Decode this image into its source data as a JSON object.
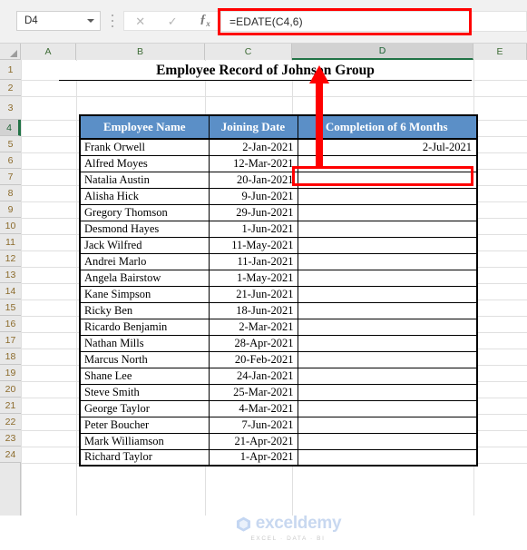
{
  "formula_bar": {
    "name_box_value": "D4",
    "formula": "=EDATE(C4,6)",
    "cancel_icon": "close-icon",
    "confirm_icon": "check-icon",
    "function_icon": "fx-icon",
    "highlight_color": "#ff0000"
  },
  "grid": {
    "column_headers": [
      "A",
      "B",
      "C",
      "D",
      "E"
    ],
    "active_column": "D",
    "active_row": 4,
    "row_headers": [
      1,
      2,
      3,
      4,
      5,
      6,
      7,
      8,
      9,
      10,
      11,
      12,
      13,
      14,
      15,
      16,
      17,
      18,
      19,
      20,
      21,
      22,
      23,
      24
    ],
    "header_accent": "#217346"
  },
  "sheet": {
    "title": "Employee Record of Johnson Group",
    "table": {
      "header_bg": "#5b8fc7",
      "header_text_color": "#ffffff",
      "columns": [
        "Employee Name",
        "Joining Date",
        "Completion of 6 Months"
      ],
      "rows": [
        {
          "name": "Frank Orwell",
          "joining": "2-Jan-2021",
          "completion": "2-Jul-2021"
        },
        {
          "name": "Alfred Moyes",
          "joining": "12-Mar-2021",
          "completion": ""
        },
        {
          "name": "Natalia Austin",
          "joining": "20-Jan-2021",
          "completion": ""
        },
        {
          "name": "Alisha Hick",
          "joining": "9-Jun-2021",
          "completion": ""
        },
        {
          "name": "Gregory Thomson",
          "joining": "29-Jun-2021",
          "completion": ""
        },
        {
          "name": "Desmond Hayes",
          "joining": "1-Jun-2021",
          "completion": ""
        },
        {
          "name": "Jack Wilfred",
          "joining": "11-May-2021",
          "completion": ""
        },
        {
          "name": "Andrei Marlo",
          "joining": "11-Jan-2021",
          "completion": ""
        },
        {
          "name": "Angela Bairstow",
          "joining": "1-May-2021",
          "completion": ""
        },
        {
          "name": "Kane Simpson",
          "joining": "21-Jun-2021",
          "completion": ""
        },
        {
          "name": "Ricky Ben",
          "joining": "18-Jun-2021",
          "completion": ""
        },
        {
          "name": "Ricardo Benjamin",
          "joining": "2-Mar-2021",
          "completion": ""
        },
        {
          "name": "Nathan Mills",
          "joining": "28-Apr-2021",
          "completion": ""
        },
        {
          "name": "Marcus North",
          "joining": "20-Feb-2021",
          "completion": ""
        },
        {
          "name": "Shane Lee",
          "joining": "24-Jan-2021",
          "completion": ""
        },
        {
          "name": "Steve Smith",
          "joining": "25-Mar-2021",
          "completion": ""
        },
        {
          "name": "George Taylor",
          "joining": "4-Mar-2021",
          "completion": ""
        },
        {
          "name": "Peter Boucher",
          "joining": "7-Jun-2021",
          "completion": ""
        },
        {
          "name": "Mark Williamson",
          "joining": "21-Apr-2021",
          "completion": ""
        },
        {
          "name": "Richard Taylor",
          "joining": "1-Apr-2021",
          "completion": ""
        }
      ]
    }
  },
  "annotations": {
    "arrow_color": "#ff0000",
    "arrow_direction": "up",
    "selected_cell": "D4",
    "selected_cell_value": "2-Jul-2021"
  },
  "watermark": {
    "brand": "exceldemy",
    "tagline": "EXCEL · DATA · BI"
  }
}
